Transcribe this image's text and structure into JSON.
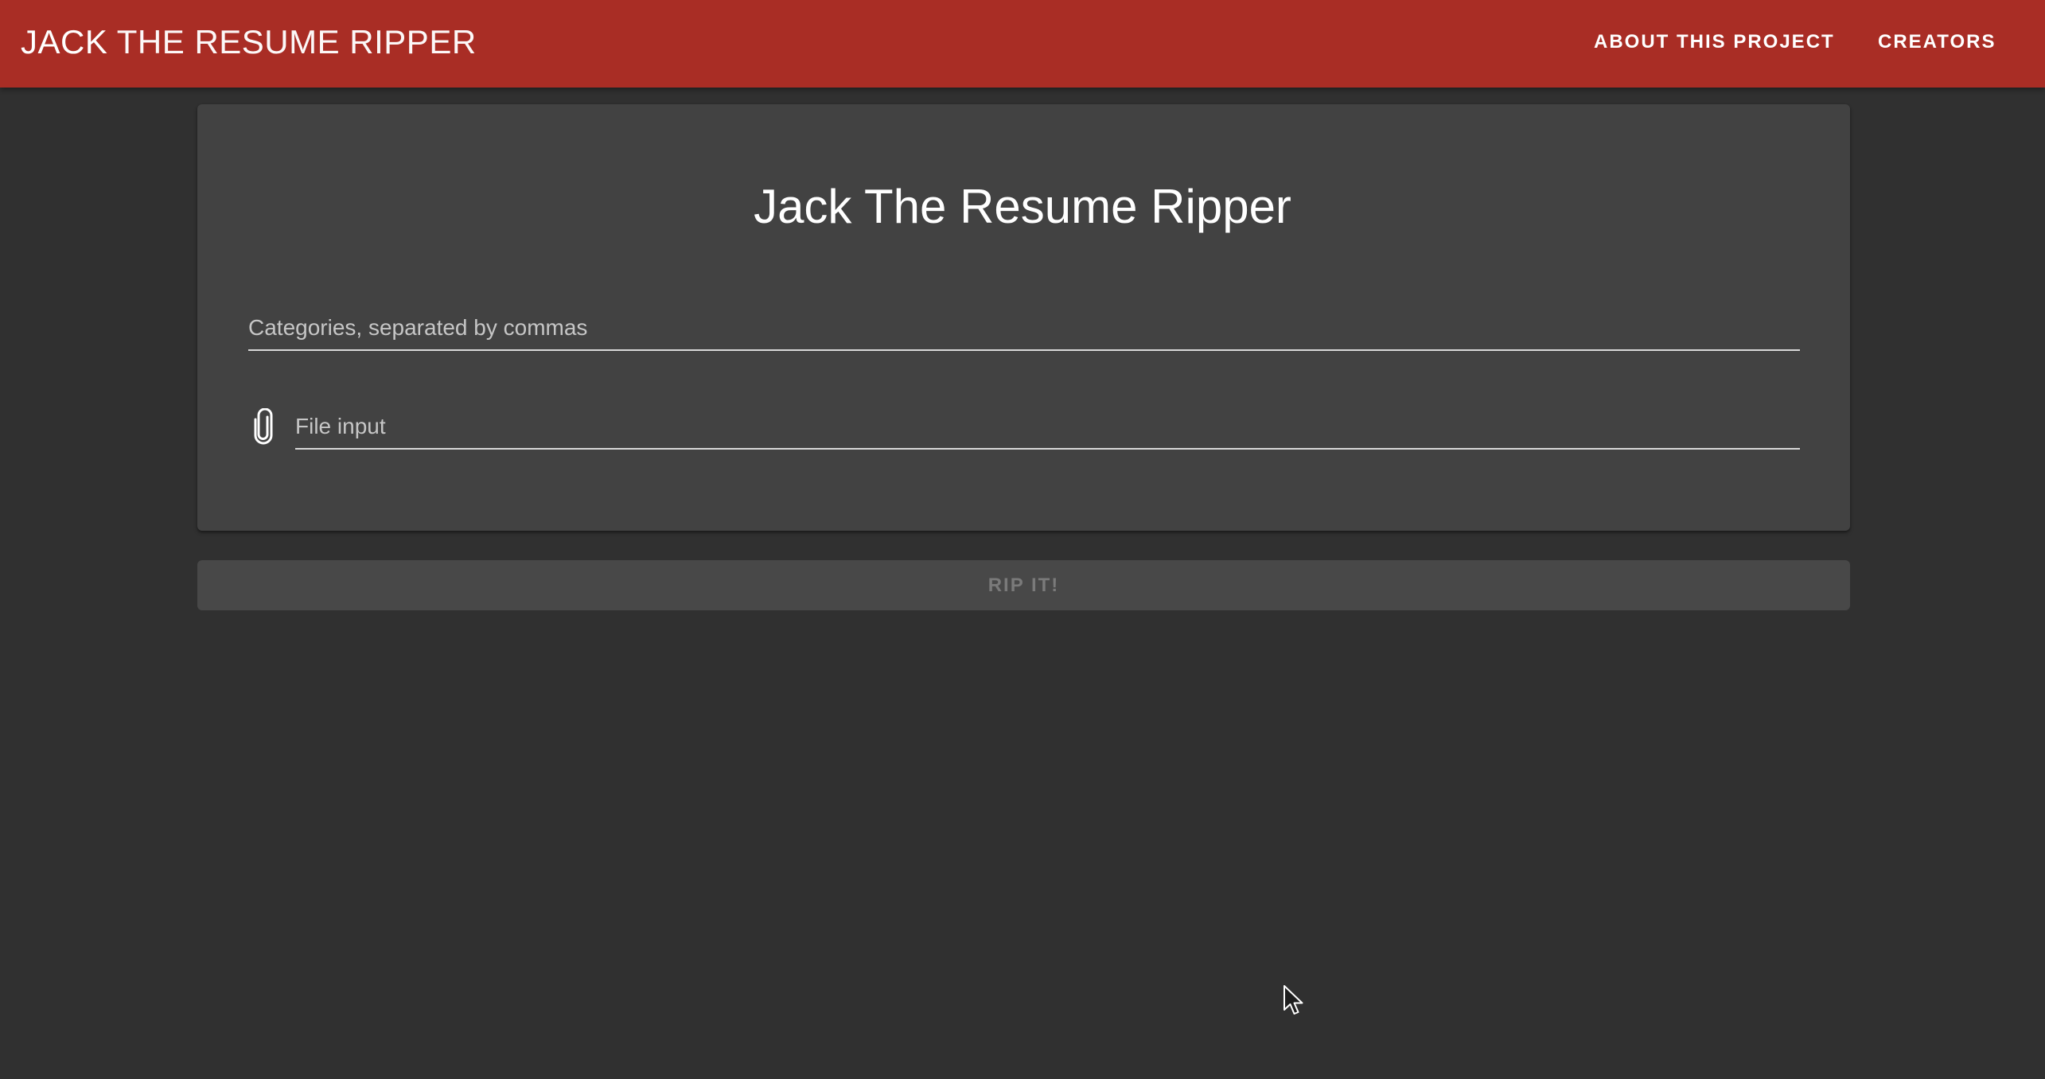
{
  "app_bar": {
    "title_first": "JACK",
    "title_rest": " THE RESUME RIPPER",
    "nav": {
      "about": "ABOUT THIS PROJECT",
      "creators": "CREATORS"
    },
    "color": "#a92d25"
  },
  "card": {
    "heading": "Jack The Resume Ripper",
    "categories_field": {
      "placeholder": "Categories, separated by commas",
      "value": ""
    },
    "file_field": {
      "icon": "paperclip-icon",
      "placeholder": "File input",
      "value": ""
    }
  },
  "actions": {
    "rip_label": "RIP IT!",
    "rip_disabled": true
  },
  "theme": {
    "background": "#303030",
    "card": "#424242"
  }
}
